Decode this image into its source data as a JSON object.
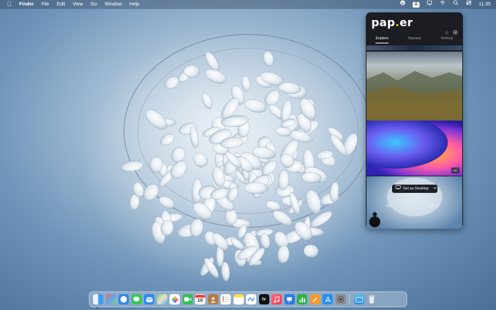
{
  "menubar": {
    "app_name": "Finder",
    "menus": [
      "File",
      "Edit",
      "View",
      "Go",
      "Window",
      "Help"
    ],
    "time": "11:35",
    "input_source": "A"
  },
  "papier": {
    "logo_text": "pap",
    "logo_dot": ".",
    "logo_tail": "er",
    "tabs": [
      "Explore",
      "Newest",
      "Vertical"
    ],
    "active_tab": "Explore",
    "badge": "5K",
    "set_desktop_label": "Set as Desktop",
    "credit_left": "@Vi",
    "credit_right": "ason"
  },
  "dock": {
    "apps": [
      {
        "name": "finder-app",
        "color": "#3a9df5"
      },
      {
        "name": "launchpad-app",
        "color": "#e8554e"
      },
      {
        "name": "safari-app",
        "color": "#1f7cf2"
      },
      {
        "name": "messages-app",
        "color": "#34c759"
      },
      {
        "name": "mail-app",
        "color": "#2d88f0"
      },
      {
        "name": "maps-app",
        "color": "#54b36a"
      },
      {
        "name": "photos-app",
        "color": "#f2a03d"
      },
      {
        "name": "facetime-app",
        "color": "#2fbf55"
      },
      {
        "name": "calendar-app",
        "color": "#ffffff"
      },
      {
        "name": "contacts-app",
        "color": "#b27a4a"
      },
      {
        "name": "reminders-app",
        "color": "#ffffff"
      },
      {
        "name": "notes-app",
        "color": "#ffd84a"
      },
      {
        "name": "freeform-app",
        "color": "#ffffff"
      },
      {
        "name": "tv-app",
        "color": "#111111"
      },
      {
        "name": "music-app",
        "color": "#fa3a55"
      },
      {
        "name": "keynote-app",
        "color": "#2d7be5"
      },
      {
        "name": "numbers-app",
        "color": "#32b34a"
      },
      {
        "name": "pages-app",
        "color": "#f59a2b"
      },
      {
        "name": "app-store-app",
        "color": "#2a8cf2"
      },
      {
        "name": "system-settings-app",
        "color": "#8e8e93"
      }
    ],
    "calendar_day": "10",
    "tv_label": "tv"
  }
}
